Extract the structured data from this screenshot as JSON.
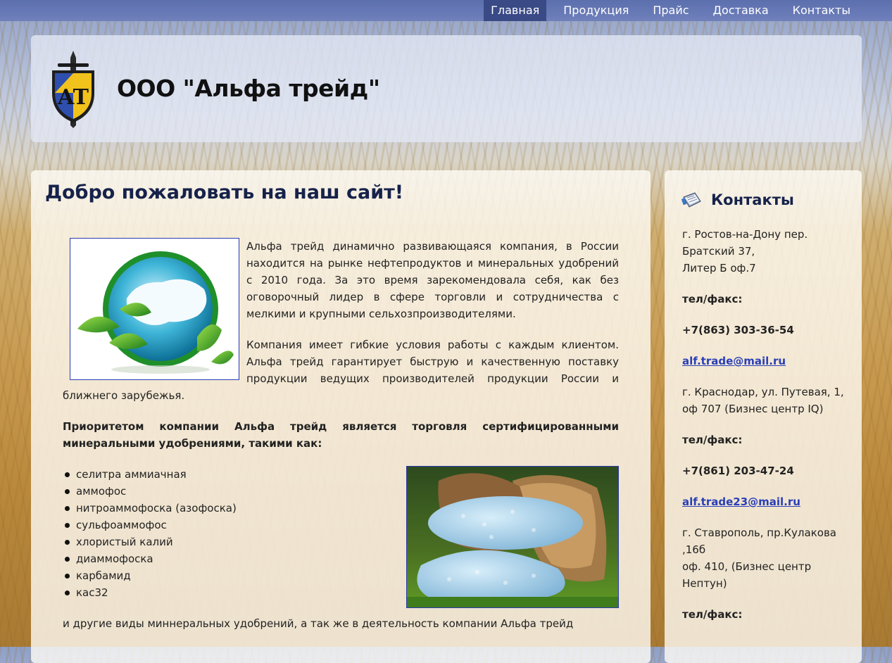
{
  "nav": {
    "items": [
      {
        "label": "Главная"
      },
      {
        "label": "Продукция"
      },
      {
        "label": "Прайс"
      },
      {
        "label": "Доставка"
      },
      {
        "label": "Контакты"
      }
    ]
  },
  "header": {
    "logo_text": "AT",
    "title": "ООО \"Альфа трейд\""
  },
  "main": {
    "heading": "Добро пожаловать на наш сайт!",
    "para1": "Альфа трейд динамично развивающаяся компания, в России находится на рынке нефтепродуктов и минеральных удобрений с 2010 года. За это время зарекомендовала себя, как без оговорочный лидер в сфере торговли и сотрудничества с мелкими и крупными сельхозпроизводителями.",
    "para2": "Компания имеет гибкие условия работы с каждым клиентом. Альфа трейд гарантирует быструю и качественную поставку продукции ведущих производителей продукции России и ближнего зарубежья.",
    "para3": "Приоритетом компании Альфа трейд является торговля сертифицированными минеральными удобрениями, такими как:",
    "fertilizers": [
      "селитра аммиачная",
      "аммофос",
      "нитроаммофоска (азофоска)",
      "сульфоаммофос",
      "хлористый калий",
      "диаммофоска",
      "карбамид",
      "кас32"
    ],
    "para4": "и другие виды миннеральных удобрений, а так же в деятельность компании Альфа трейд"
  },
  "sidebar": {
    "title": "Контакты",
    "offices": [
      {
        "address_lines": [
          "г. Ростов-на-Дону пер. Братский 37,",
          "Литер Б оф.7"
        ],
        "phone_label": "тел/факс:",
        "phone": "+7(863) 303-36-54",
        "email": "alf.trade@mail.ru"
      },
      {
        "address_lines": [
          "г. Краснодар, ул. Путевая, 1,",
          "оф 707 (Бизнес центр IQ)"
        ],
        "phone_label": "тел/факс:",
        "phone": "+7(861) 203-47-24",
        "email": "alf.trade23@mail.ru"
      },
      {
        "address_lines": [
          "г. Ставрополь, пр.Кулакова ,16б",
          "оф. 410, (Бизнес центр Нептун)"
        ],
        "phone_label": "тел/факс:"
      }
    ]
  }
}
